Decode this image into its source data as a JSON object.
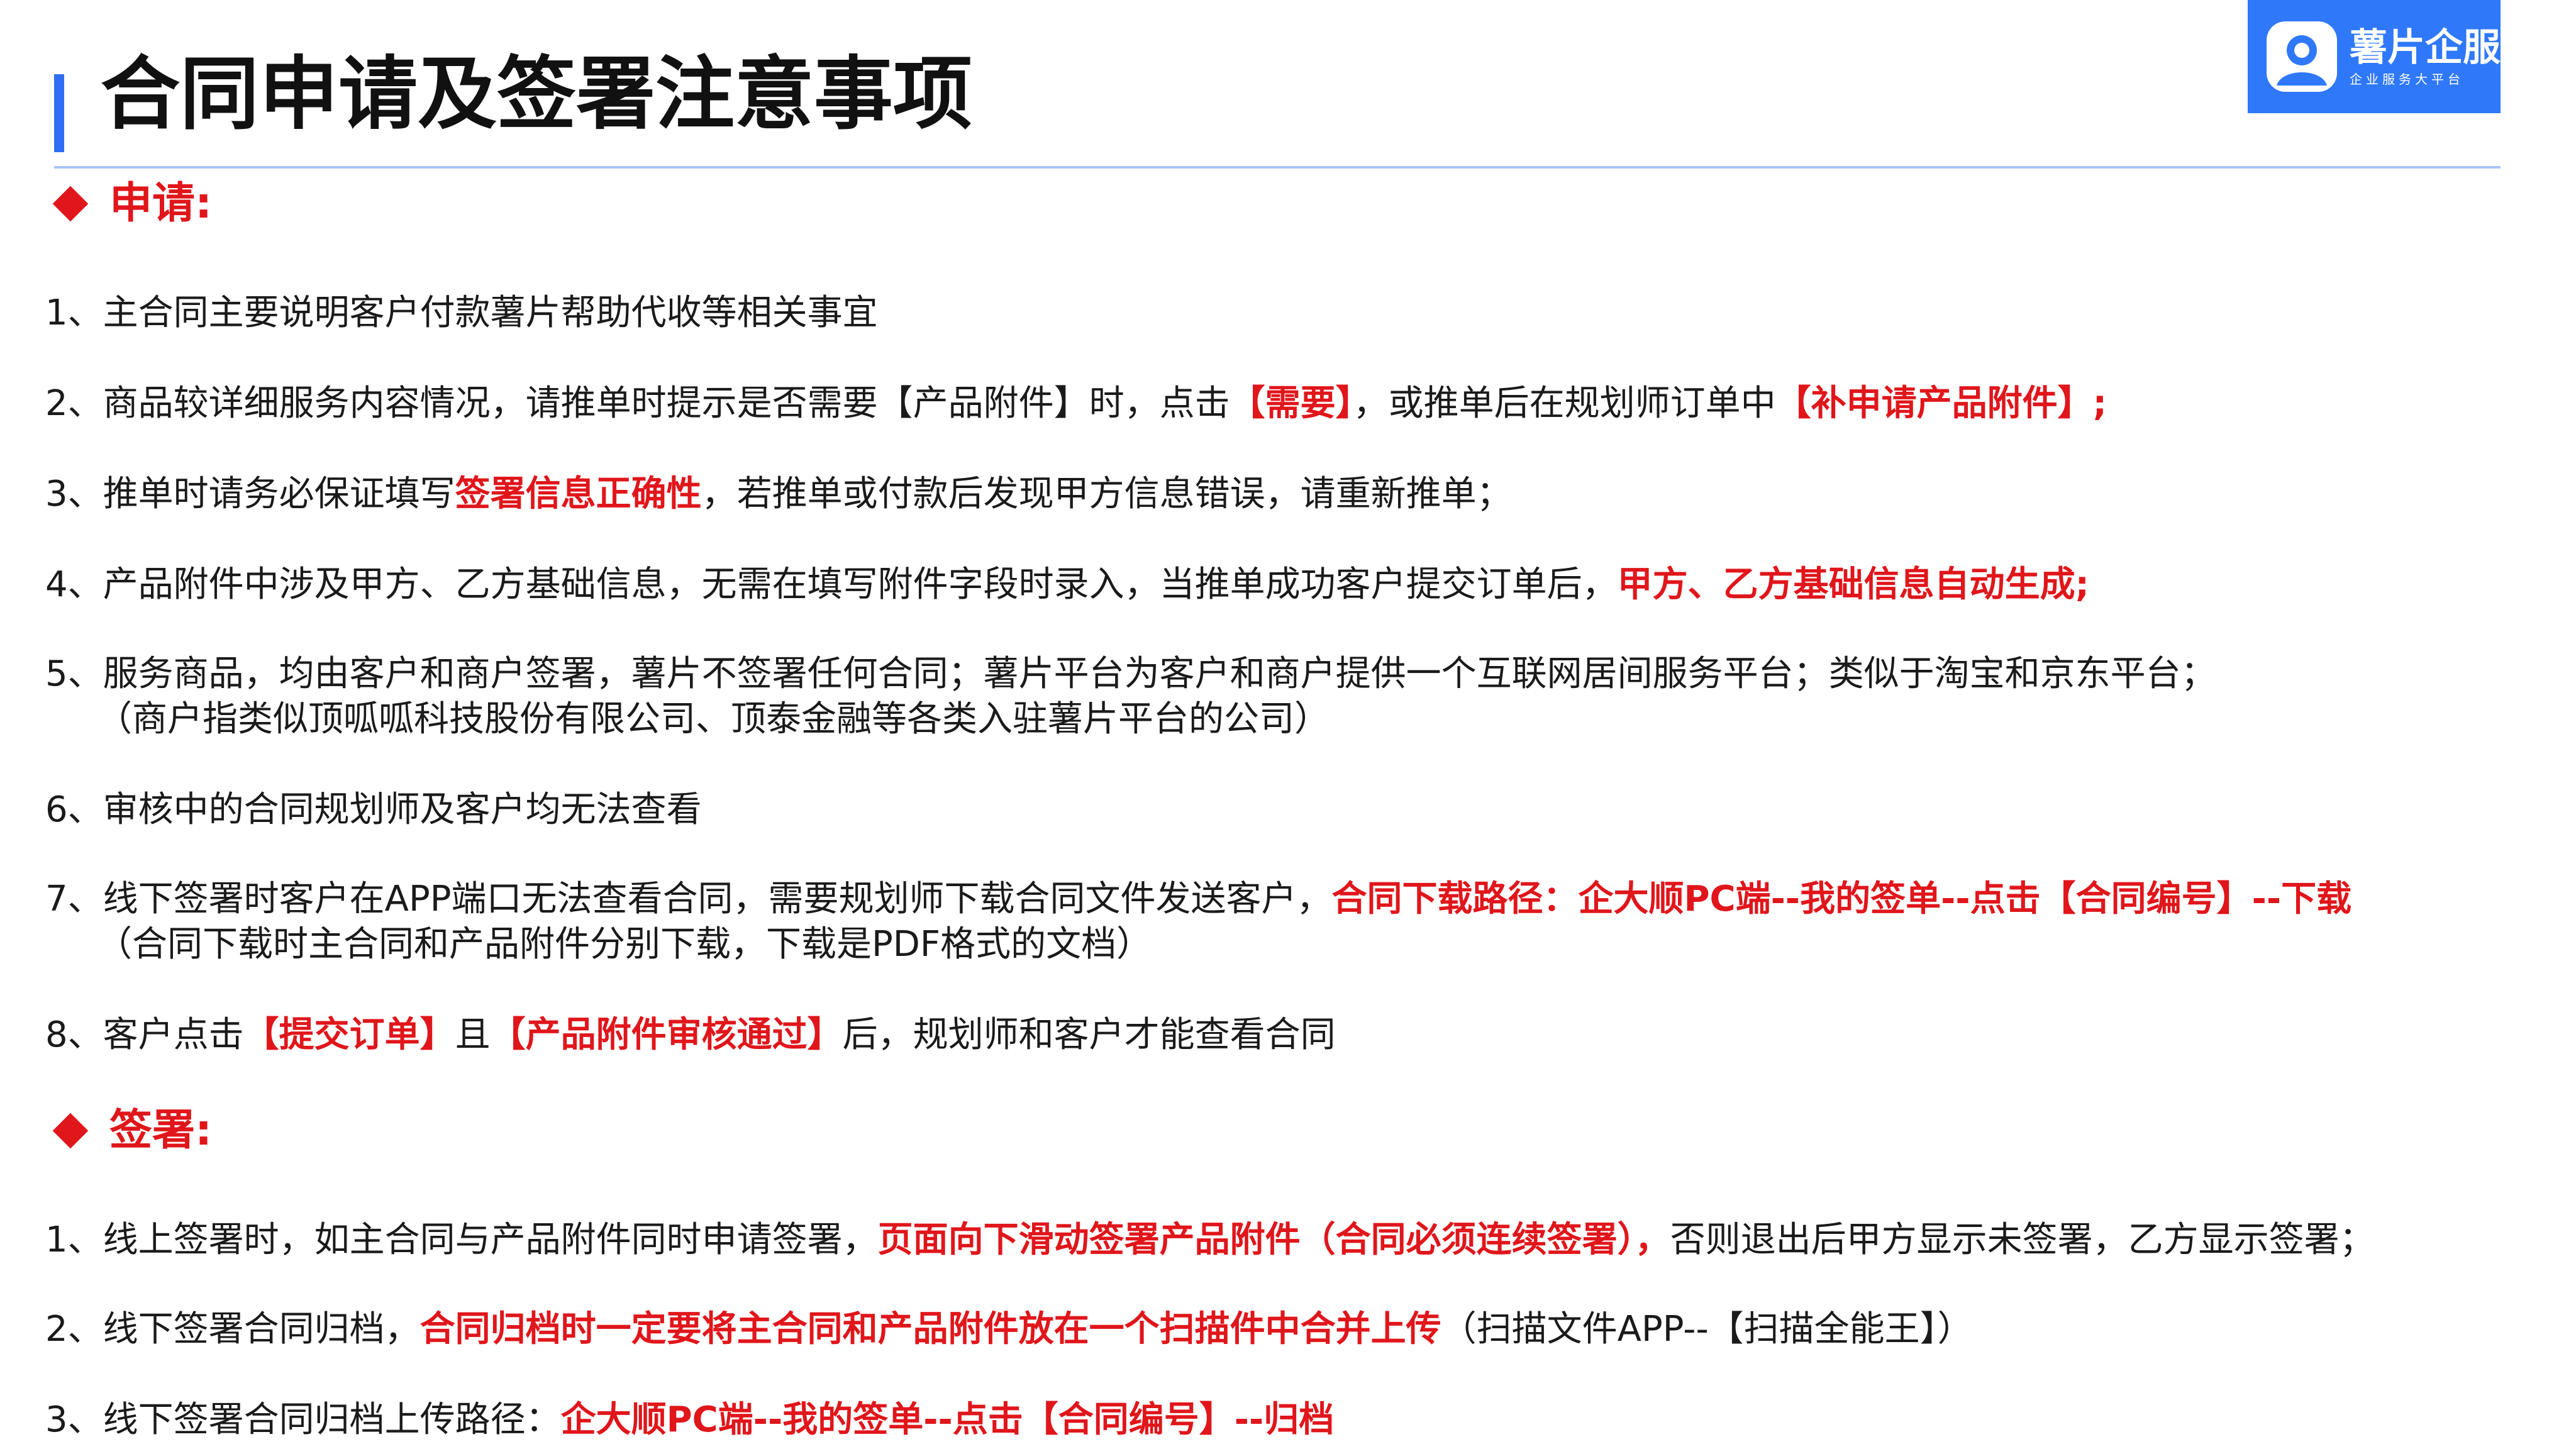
{
  "header": {
    "title": "合同申请及签署注意事项"
  },
  "logo": {
    "name": "薯片企服",
    "tagline": "企业服务大平台",
    "icon": "person-icon"
  },
  "colors": {
    "accent": "#2f78fa",
    "highlight": "#e0161b"
  },
  "section_apply": {
    "title": "申请:",
    "items": [
      {
        "parts": [
          "1、主合同主要说明客户付款薯片帮助代收等相关事宜"
        ]
      },
      {
        "parts": [
          "2、商品较详细服务内容情况，请推单时提示是否需要【产品附件】时，点击",
          "【需要】",
          "，或推单后在规划师订单中",
          "【补申请产品附件】;"
        ]
      },
      {
        "parts": [
          "3、推单时请务必保证填写",
          "签署信息正确性",
          "，若推单或付款后发现甲方信息错误，请重新推单；"
        ]
      },
      {
        "parts": [
          "4、产品附件中涉及甲方、乙方基础信息，无需在填写附件字段时录入，当推单成功客户提交订单后，",
          "甲方、乙方基础信息自动生成;"
        ]
      },
      {
        "parts": [
          "5、服务商品，均由客户和商户签署，薯片不签署任何合同；薯片平台为客户和商户提供一个互联网居间服务平台；类似于淘宝和京东平台；"
        ],
        "sub": "（商户指类似顶呱呱科技股份有限公司、顶泰金融等各类入驻薯片平台的公司）"
      },
      {
        "parts": [
          "6、审核中的合同规划师及客户均无法查看"
        ]
      },
      {
        "parts": [
          "7、线下签署时客户在APP端口无法查看合同，需要规划师下载合同文件发送客户，",
          "合同下载路径：企大顺PC端--我的签单--点击【合同编号】--下载"
        ],
        "sub": "（合同下载时主合同和产品附件分别下载，下载是PDF格式的文档）"
      },
      {
        "parts": [
          "8、客户点击",
          "【提交订单】",
          "且",
          "【产品附件审核通过】",
          "后，规划师和客户才能查看合同"
        ]
      }
    ]
  },
  "section_sign": {
    "title": "签署:",
    "items": [
      {
        "parts": [
          "1、线上签署时，如主合同与产品附件同时申请签署，",
          "页面向下滑动签署产品附件（合同必须连续签署），",
          "否则退出后甲方显示未签署，乙方显示签署；"
        ]
      },
      {
        "parts": [
          "2、线下签署合同归档，",
          "合同归档时一定要将主合同和产品附件放在一个扫描件中合并上传",
          "（扫描文件APP--【扫描全能王】）"
        ]
      },
      {
        "parts": [
          "3、线下签署合同归档上传路径：",
          "企大顺PC端--我的签单--点击【合同编号】--归档"
        ]
      }
    ]
  }
}
